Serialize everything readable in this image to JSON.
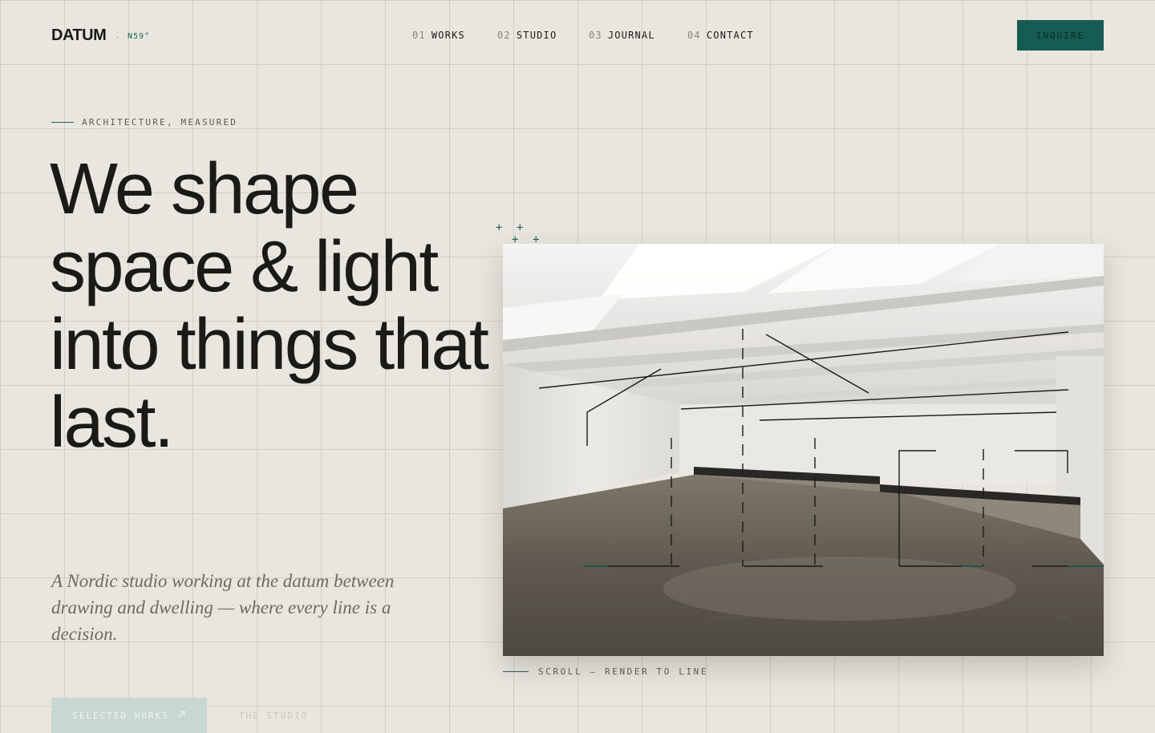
{
  "header": {
    "logo": "DATUM",
    "logo_separator": "·",
    "coordinate": "N59°",
    "nav": [
      {
        "num": "01",
        "label": "WORKS"
      },
      {
        "num": "02",
        "label": "STUDIO"
      },
      {
        "num": "03",
        "label": "JOURNAL"
      },
      {
        "num": "04",
        "label": "CONTACT"
      }
    ],
    "cta_label": "INQUIRE"
  },
  "hero": {
    "eyebrow": "ARCHITECTURE, MEASURED",
    "headline": "We shape space & light into things that last.",
    "lede": "A Nordic studio working at the datum between drawing and dwelling — where every line is a decision.",
    "primary_cta": "SELECTED WORKS",
    "primary_cta_icon": "arrow-up-right-icon",
    "secondary_cta": "THE STUDIO",
    "scroll_cue": "SCROLL — RENDER TO LINE",
    "crosshair_glyph": "+"
  },
  "colors": {
    "background": "#e9e6df",
    "ink": "#1a1a16",
    "accent": "#175c52",
    "muted": "#6e6a61"
  }
}
